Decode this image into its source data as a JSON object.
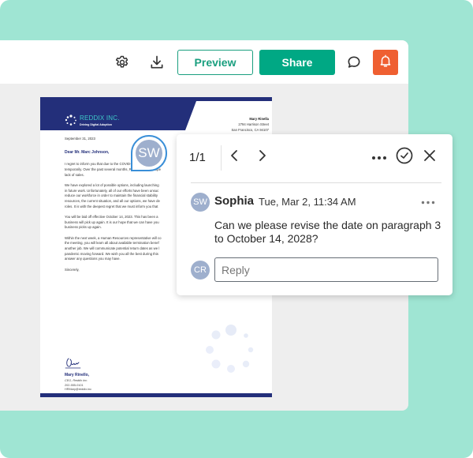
{
  "toolbar": {
    "settings_icon": "gear-icon",
    "download_icon": "download-icon",
    "preview_label": "Preview",
    "share_label": "Share",
    "comment_icon": "speech-bubble-icon",
    "notification_icon": "bell-icon"
  },
  "colors": {
    "background": "#9fe5d3",
    "primary": "#00a884",
    "notification": "#ef5f31",
    "doc_brand": "#232f7a",
    "avatar": "#9eafcd"
  },
  "document": {
    "company_name": "REDDIX INC.",
    "company_tagline": "Driving Digital Adoption",
    "sender_name": "Mary Rinella",
    "sender_street": "2794 Harrison Street",
    "sender_city": "San Francisco, CA 94107",
    "date": "September 31, 2023",
    "greeting": "Dear Mr. Marc Johnson,",
    "paragraphs": [
      [
        "I regret to inform you that due to the COVID-19 pandemic, Reddix",
        "temporarily. Over the past several months, Reddix Inc. has expe",
        "lack of sales."
      ],
      [
        "We have explored a lot of possible options, including launching",
        "in future work. Unfortunately, all of our efforts have been unsuc",
        "reduce our workforce in order to maintain the financial stability",
        "resources, the current situation, and all our options, we have de",
        "roles. It is with the deepest regret that we must inform you that"
      ],
      [
        "You will be laid off effective October 14, 2023. This has been a",
        "business will pick up again. It is our hope that we can have you",
        "business picks up again."
      ],
      [
        "Within the next week, a Human Resources representative will co",
        "the meeting, you will learn all about available termination benef",
        "another job. We will communicate potential return dates as we l",
        "pandemic moving forward. We wish you all the best during this",
        "answer any questions you may have."
      ]
    ],
    "closing": "Sincerely,",
    "signature_name": "Mary Rinello,",
    "signature_title": "CEO, Reddix Inc.",
    "signature_phone": "202-555-0101",
    "signature_email": "HRMary@reddix.inc"
  },
  "marker": {
    "initials": "SW"
  },
  "comment_popup": {
    "counter": "1/1",
    "prev_icon": "chevron-left-icon",
    "next_icon": "chevron-right-icon",
    "more_icon": "more-horizontal-icon",
    "resolve_icon": "check-circle-icon",
    "close_icon": "close-icon",
    "comment": {
      "initials": "SW",
      "author": "Sophia",
      "timestamp": "Tue, Mar 2, 11:34 AM",
      "text": "Can we please revise the date on paragraph 3 to October 14, 2028?"
    },
    "reply": {
      "initials": "CR",
      "placeholder": "Reply",
      "value": ""
    }
  }
}
